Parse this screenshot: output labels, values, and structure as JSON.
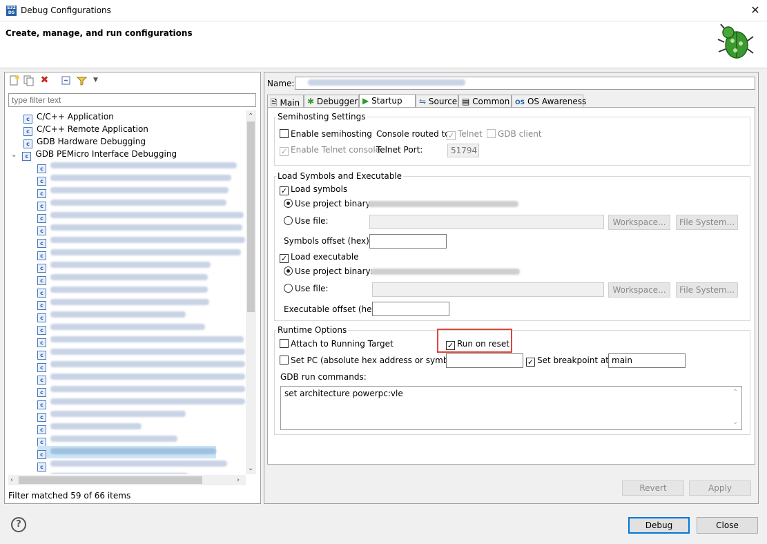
{
  "window": {
    "title": "Debug Configurations",
    "close_label": "✕",
    "app_icon_text": "S32 DS"
  },
  "banner": {
    "title": "Create, manage, and run configurations"
  },
  "left": {
    "filter_placeholder": "type filter text",
    "tree": [
      {
        "label": "C/C++ Application"
      },
      {
        "label": "C/C++ Remote Application"
      },
      {
        "label": "GDB Hardware Debugging"
      },
      {
        "label": "GDB PEMicro Interface Debugging"
      }
    ],
    "status": "Filter matched 59 of 66 items",
    "icons": [
      "new-config-icon",
      "duplicate-icon",
      "delete-icon",
      "collapse-all-icon",
      "filter-icon",
      "dropdown-icon"
    ]
  },
  "right": {
    "name_label": "Name:",
    "tabs": [
      "Main",
      "Debugger",
      "Startup",
      "Source",
      "Common",
      "OS Awareness"
    ],
    "active_tab": "Startup",
    "semihosting": {
      "title": "Semihosting Settings",
      "enable_semihosting": "Enable semihosting",
      "console_routed": "Console routed to:",
      "telnet": "Telnet",
      "gdb_client": "GDB client",
      "enable_telnet_console": "Enable Telnet console",
      "telnet_port_label": "Telnet Port:",
      "telnet_port": "51794"
    },
    "load": {
      "title": "Load Symbols and Executable",
      "load_symbols": "Load symbols",
      "use_project_binary": "Use project binary:",
      "use_file": "Use file:",
      "workspace": "Workspace...",
      "file_system": "File System...",
      "symbols_offset": "Symbols offset (hex):",
      "load_executable": "Load executable",
      "executable_offset": "Executable offset (hex):"
    },
    "runtime": {
      "title": "Runtime Options",
      "attach": "Attach to Running Target",
      "run_on_reset": "Run on reset",
      "set_pc": "Set PC (absolute hex address or symbol):",
      "set_breakpoint": "Set breakpoint at:",
      "breakpoint_value": "main",
      "gdb_run_commands": "GDB run commands:",
      "commands_value": "set architecture powerpc:vle"
    },
    "revert": "Revert",
    "apply": "Apply"
  },
  "footer": {
    "help": "?",
    "debug": "Debug",
    "close": "Close"
  }
}
